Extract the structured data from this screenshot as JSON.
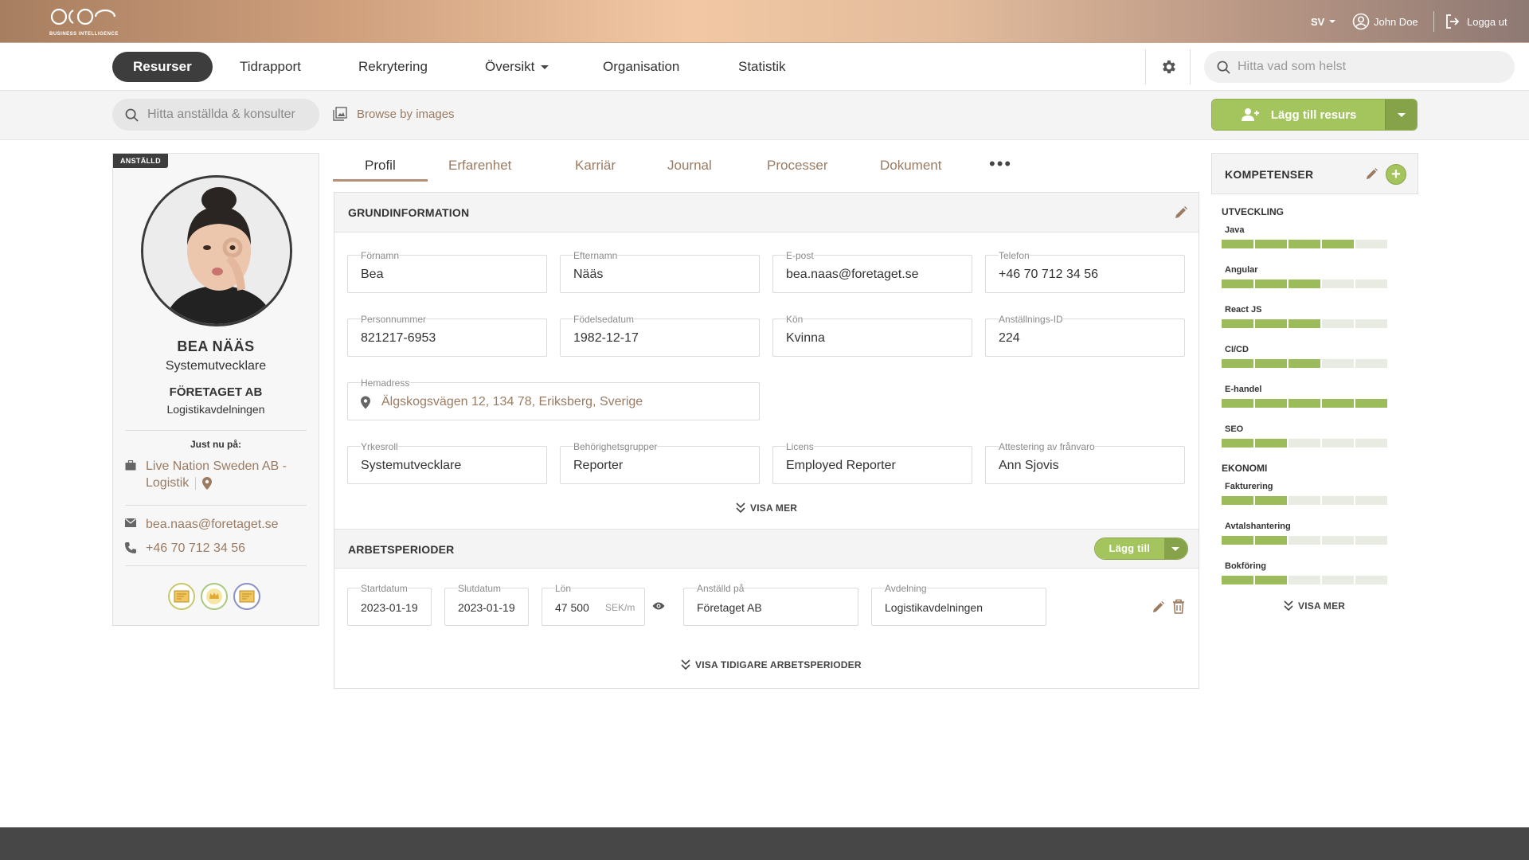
{
  "topbar": {
    "logo_text": "BUSINESS INTELLIGENCE",
    "language": "SV",
    "user_name": "John Doe",
    "logout_label": "Logga ut"
  },
  "nav": {
    "items": [
      "Resurser",
      "Tidrapport",
      "Rekrytering",
      "Översikt",
      "Organisation",
      "Statistik"
    ],
    "active": "Resurser",
    "search_placeholder": "Hitta vad som helst"
  },
  "subbar": {
    "employee_search_placeholder": "Hitta anställda & konsulter",
    "browse_label": "Browse by images",
    "add_resource_label": "Lägg till resurs"
  },
  "profile": {
    "status_badge": "ANSTÄLLD",
    "name": "BEA NÄÄS",
    "title": "Systemutvecklare",
    "company": "FÖRETAGET AB",
    "department": "Logistikavdelningen",
    "current_label": "Just nu på:",
    "current_assignment_line1": "Live Nation Sweden AB -",
    "current_assignment_line2": "Logistik",
    "email": "bea.naas@foretaget.se",
    "phone": "+46 70 712 34 56"
  },
  "tabs": [
    "Profil",
    "Erfarenhet",
    "Karriär",
    "Journal",
    "Processer",
    "Dokument"
  ],
  "basic_info": {
    "heading": "GRUNDINFORMATION",
    "fields": [
      {
        "label": "Förnamn",
        "value": "Bea"
      },
      {
        "label": "Efternamn",
        "value": "Nääs"
      },
      {
        "label": "E-post",
        "value": "bea.naas@foretaget.se"
      },
      {
        "label": "Telefon",
        "value": "+46 70 712 34 56"
      },
      {
        "label": "Personnummer",
        "value": "821217-6953"
      },
      {
        "label": "Födelsedatum",
        "value": "1982-12-17"
      },
      {
        "label": "Kön",
        "value": "Kvinna"
      },
      {
        "label": "Anställnings-ID",
        "value": "224"
      },
      {
        "label": "Hemadress",
        "value": "Älgskogsvägen 12, 134 78, Eriksberg, Sverige"
      },
      {
        "label": "Yrkesroll",
        "value": "Systemutvecklare"
      },
      {
        "label": "Behörighetsgrupper",
        "value": "Reporter"
      },
      {
        "label": "Licens",
        "value": "Employed Reporter"
      },
      {
        "label": "Attestering av frånvaro",
        "value": "Ann Sjovis"
      }
    ],
    "show_more": "VISA MER"
  },
  "work_periods": {
    "heading": "ARBETSPERIODER",
    "add_label": "Lägg till",
    "start_label": "Startdatum",
    "start": "2023-01-19",
    "end_label": "Slutdatum",
    "end": "2023-01-19",
    "salary_label": "Lön",
    "salary": "47 500",
    "salary_unit": "SEK/m",
    "employer_label": "Anställd på",
    "employer": "Företaget AB",
    "dept_label": "Avdelning",
    "dept": "Logistikavdelningen",
    "show_previous": "VISA TIDIGARE ARBETSPERIODER"
  },
  "competences": {
    "heading": "KOMPETENSER",
    "categories": [
      {
        "name": "UTVECKLING",
        "skills": [
          {
            "name": "Java",
            "level": 4
          },
          {
            "name": "Angular",
            "level": 3
          },
          {
            "name": "React JS",
            "level": 3
          },
          {
            "name": "CI/CD",
            "level": 3
          },
          {
            "name": "E-handel",
            "level": 5
          },
          {
            "name": "SEO",
            "level": 2
          }
        ]
      },
      {
        "name": "EKONOMI",
        "skills": [
          {
            "name": "Fakturering",
            "level": 2
          },
          {
            "name": "Avtalshantering",
            "level": 2
          },
          {
            "name": "Bokföring",
            "level": 2
          }
        ]
      }
    ],
    "max_level": 5,
    "show_more": "VISA MER"
  },
  "colors": {
    "accent_green": "#a4c45d",
    "link_brown": "#9b7b62",
    "dark": "#3d3d3d"
  }
}
